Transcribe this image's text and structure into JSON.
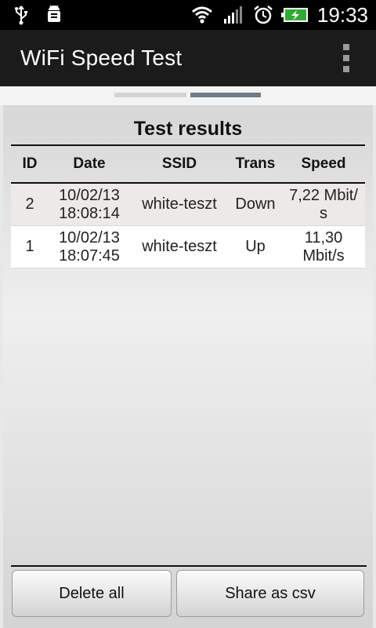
{
  "status_bar": {
    "time": "19:33",
    "left_icons": [
      "usb-icon",
      "android-debug-icon"
    ],
    "right_icons": [
      "wifi-icon",
      "signal-icon",
      "alarm-icon",
      "battery-charging-icon"
    ]
  },
  "action_bar": {
    "title": "WiFi Speed Test",
    "overflow_icon": "overflow-menu-icon"
  },
  "pager": {
    "pages": 2,
    "active_index": 1
  },
  "results": {
    "title": "Test results",
    "columns": {
      "id": "ID",
      "date": "Date",
      "ssid": "SSID",
      "trans": "Trans",
      "speed": "Speed"
    },
    "rows": [
      {
        "id": "2",
        "date_line1": "10/02/13",
        "date_line2": "18:08:14",
        "ssid": "white-teszt",
        "trans": "Down",
        "speed_line1": "7,22 Mbit/",
        "speed_line2": "s"
      },
      {
        "id": "1",
        "date_line1": "10/02/13",
        "date_line2": "18:07:45",
        "ssid": "white-teszt",
        "trans": "Up",
        "speed_line1": "11,30",
        "speed_line2": "Mbit/s"
      }
    ]
  },
  "buttons": {
    "delete_all": "Delete all",
    "share_csv": "Share as csv"
  },
  "colors": {
    "action_bar": "#1b1b1b",
    "pager_active": "#6f7d8a",
    "row_alt": "#ece9e8"
  }
}
